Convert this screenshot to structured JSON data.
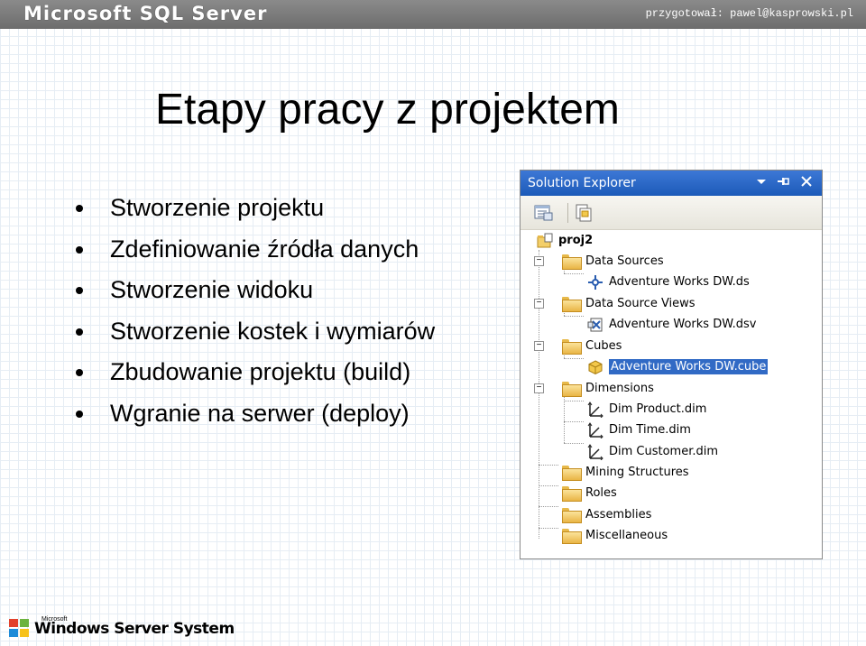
{
  "header": {
    "brand": "Microsoft SQL Server",
    "credit": "przygotował: pawel@kasprowski.pl"
  },
  "slide": {
    "title": "Etapy pracy z projektem",
    "bullets": [
      "Stworzenie projektu",
      "Zdefiniowanie źródła danych",
      "Stworzenie widoku",
      "Stworzenie kostek i wymiarów",
      "Zbudowanie projektu (build)",
      "Wgranie na serwer (deploy)"
    ]
  },
  "solution_explorer": {
    "title": "Solution Explorer",
    "controls": {
      "dropdown_icon": "chevron-down-icon",
      "pin_icon": "pin-icon",
      "close_icon": "close-icon"
    },
    "toolbar": [
      "properties-icon",
      "show-all-files-icon"
    ],
    "project": "proj2",
    "tree": {
      "data_sources": "Data Sources",
      "data_source_file": "Adventure Works DW.ds",
      "data_source_views": "Data Source Views",
      "data_source_view_file": "Adventure Works DW.dsv",
      "cubes": "Cubes",
      "cube_file": "Adventure Works DW.cube",
      "dimensions": "Dimensions",
      "dim_product": "Dim Product.dim",
      "dim_time": "Dim Time.dim",
      "dim_customer": "Dim Customer.dim",
      "mining_structures": "Mining Structures",
      "roles": "Roles",
      "assemblies": "Assemblies",
      "miscellaneous": "Miscellaneous"
    },
    "selected_item": "Adventure Works DW.cube",
    "colors": {
      "titlebar": "#1c5ab8",
      "selection": "#316ac5",
      "folder": "#e9b545"
    }
  },
  "footer": {
    "logo_text": "Windows Server System",
    "logo_prefix": "Microsoft"
  }
}
